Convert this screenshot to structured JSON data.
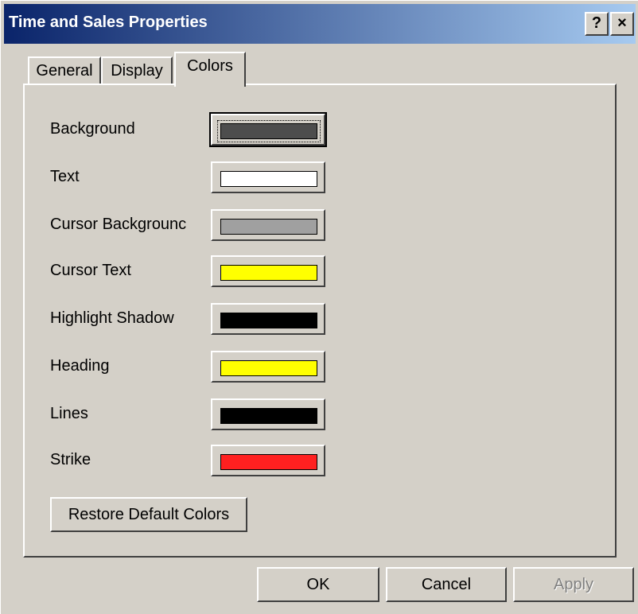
{
  "window": {
    "title": "Time and Sales Properties",
    "help_button": "?",
    "close_button": "×"
  },
  "tabs": [
    {
      "label": "General",
      "active": false
    },
    {
      "label": "Display",
      "active": false
    },
    {
      "label": "Colors",
      "active": true
    }
  ],
  "colors": [
    {
      "label": "Background",
      "color": "#4d4d4d"
    },
    {
      "label": "Text",
      "color": "#ffffff"
    },
    {
      "label": "Cursor Backgrounc",
      "color": "#a0a0a0"
    },
    {
      "label": "Cursor Text",
      "color": "#ffff00"
    },
    {
      "label": "Highlight Shadow",
      "color": "#000000"
    },
    {
      "label": "Heading",
      "color": "#ffff00"
    },
    {
      "label": "Lines",
      "color": "#000000"
    },
    {
      "label": "Strike",
      "color": "#ff2020"
    }
  ],
  "restore_button": "Restore Default Colors",
  "buttons": {
    "ok": "OK",
    "cancel": "Cancel",
    "apply": "Apply"
  }
}
